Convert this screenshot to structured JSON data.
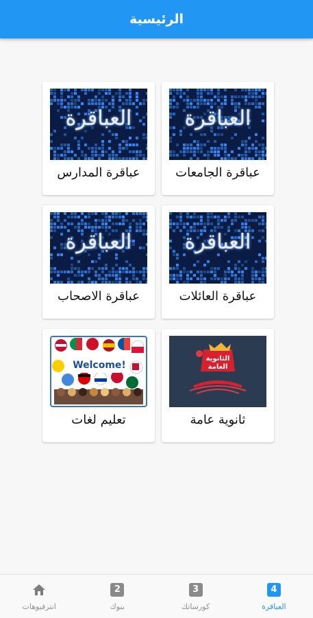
{
  "app_bar": {
    "title": "الرئيسية"
  },
  "cards": [
    {
      "label": "عباقرة الجامعات",
      "image": "genius-banner",
      "image_text": "العباقرة"
    },
    {
      "label": "عباقرة المدارس",
      "image": "genius-banner",
      "image_text": "العباقرة"
    },
    {
      "label": "عباقرة العائلات",
      "image": "genius-banner",
      "image_text": "العباقرة"
    },
    {
      "label": "عباقرة الاصحاب",
      "image": "genius-banner",
      "image_text": "العباقرة"
    },
    {
      "label": "ثانوية عامة",
      "image": "thanawya-banner",
      "image_text": "الثانوية العامة"
    },
    {
      "label": "تعليم لغات",
      "image": "languages-banner",
      "image_text": "Welcome!"
    }
  ],
  "bottom_nav": {
    "items": [
      {
        "label": "العباقرة",
        "badge": "4",
        "icon": "badge-4-icon",
        "active": true
      },
      {
        "label": "كورساتك",
        "badge": "3",
        "icon": "badge-3-icon",
        "active": false
      },
      {
        "label": "بنوك",
        "badge": "2",
        "icon": "badge-2-icon",
        "active": false
      },
      {
        "label": "انترفيوهات",
        "badge": "",
        "icon": "home-icon",
        "active": false
      }
    ]
  },
  "colors": {
    "primary": "#2196f3",
    "inactive": "#8f8f8f",
    "banner_dark": "#0a1c44"
  }
}
